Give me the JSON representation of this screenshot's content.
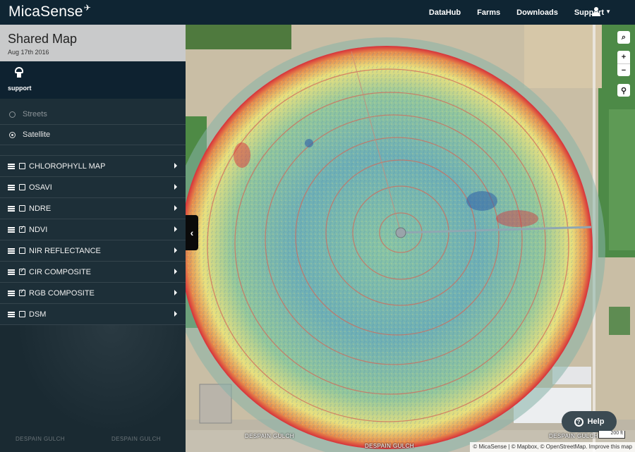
{
  "brand": {
    "name": "MicaSense"
  },
  "nav": {
    "links": [
      "DataHub",
      "Farms",
      "Downloads",
      "Support"
    ]
  },
  "sidebar": {
    "title": "Shared Map",
    "date": "Aug 17th 2016",
    "support_label": "support",
    "base_layers": [
      {
        "label": "Streets",
        "selected": false
      },
      {
        "label": "Satellite",
        "selected": true
      }
    ],
    "layers": [
      {
        "label": "CHLOROPHYLL MAP",
        "checked": false
      },
      {
        "label": "OSAVI",
        "checked": false
      },
      {
        "label": "NDRE",
        "checked": false
      },
      {
        "label": "NDVI",
        "checked": true
      },
      {
        "label": "NIR REFLECTANCE",
        "checked": false
      },
      {
        "label": "CIR COMPOSITE",
        "checked": true
      },
      {
        "label": "RGB COMPOSITE",
        "checked": true
      },
      {
        "label": "DSM",
        "checked": false
      }
    ],
    "road_labels": [
      "DESPAIN GULCH",
      "DESPAIN GULCH"
    ]
  },
  "map": {
    "road_labels": [
      "DESPAIN GULCH",
      "DESPAIN GULCH",
      "DESPAIN GULCH"
    ],
    "help_label": "Help",
    "scale_label": "200 ft",
    "attribution": "© MicaSense | © Mapbox, © OpenStreetMap. Improve this map",
    "controls": {
      "zoom_in": "+",
      "zoom_out": "−"
    }
  },
  "colors": {
    "navbar": "#0f2533",
    "sidebar": "#1d2f38",
    "ndvi_low": "#d7303a",
    "ndvi_mid": "#f2e27a",
    "ndvi_high": "#3f7fbf"
  }
}
